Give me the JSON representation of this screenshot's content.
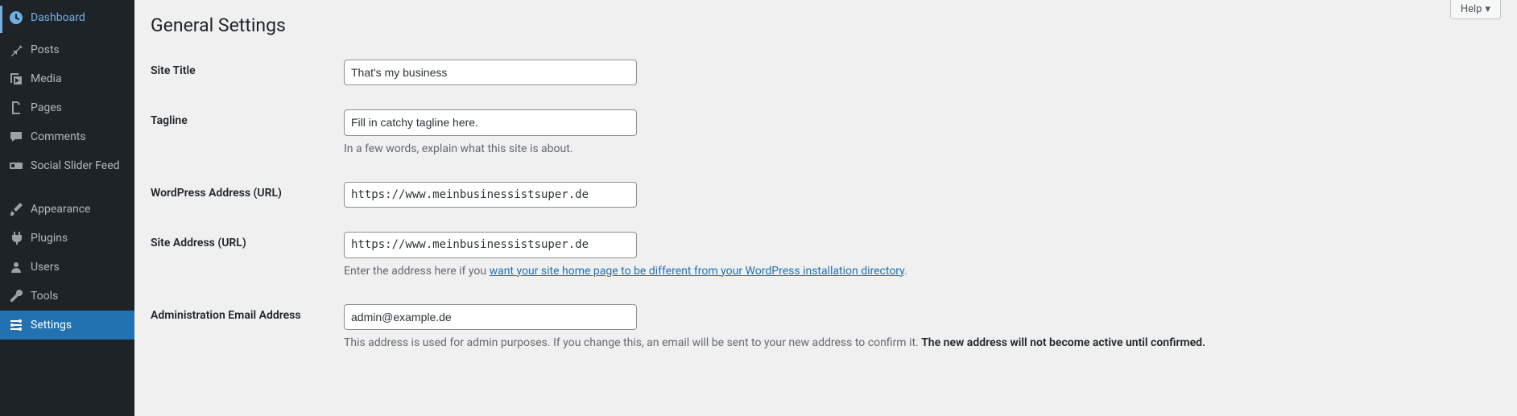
{
  "sidebar": {
    "items": [
      {
        "label": "Dashboard"
      },
      {
        "label": "Posts"
      },
      {
        "label": "Media"
      },
      {
        "label": "Pages"
      },
      {
        "label": "Comments"
      },
      {
        "label": "Social Slider Feed"
      },
      {
        "label": "Appearance"
      },
      {
        "label": "Plugins"
      },
      {
        "label": "Users"
      },
      {
        "label": "Tools"
      },
      {
        "label": "Settings"
      }
    ]
  },
  "header": {
    "help_label": "Help",
    "page_title": "General Settings"
  },
  "form": {
    "site_title": {
      "label": "Site Title",
      "value": "That's my business"
    },
    "tagline": {
      "label": "Tagline",
      "value": "Fill in catchy tagline here.",
      "description": "In a few words, explain what this site is about."
    },
    "wp_address": {
      "label": "WordPress Address (URL)",
      "value": "https://www.meinbusinessistsuper.de"
    },
    "site_address": {
      "label": "Site Address (URL)",
      "value": "https://www.meinbusinessistsuper.de",
      "desc_prefix": "Enter the address here if you ",
      "desc_link": "want your site home page to be different from your WordPress installation directory",
      "desc_suffix": "."
    },
    "admin_email": {
      "label": "Administration Email Address",
      "value": "admin@example.de",
      "desc_prefix": "This address is used for admin purposes. If you change this, an email will be sent to your new address to confirm it. ",
      "desc_bold": "The new address will not become active until confirmed."
    }
  }
}
